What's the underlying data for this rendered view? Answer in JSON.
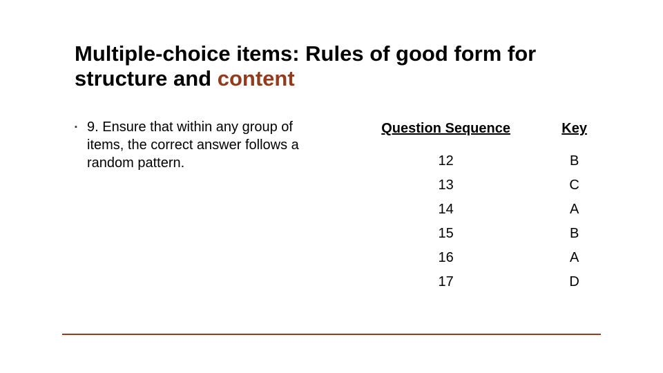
{
  "title_full": "Multiple-choice items:  Rules of good form for structure and content",
  "title_plain_leading": "Multiple-choice items:  Rules of good form for",
  "title_plain_trailing": "structure and ",
  "title_accent": "content",
  "bullet": "9.  Ensure that within any group of items, the correct answer follows a random pattern.",
  "table": {
    "headers": {
      "col1": "Question Sequence",
      "col2": "Key"
    },
    "rows": [
      {
        "q": "12",
        "k": "B"
      },
      {
        "q": "13",
        "k": "C"
      },
      {
        "q": "14",
        "k": "A"
      },
      {
        "q": "15",
        "k": "B"
      },
      {
        "q": "16",
        "k": "A"
      },
      {
        "q": "17",
        "k": "D"
      }
    ]
  }
}
